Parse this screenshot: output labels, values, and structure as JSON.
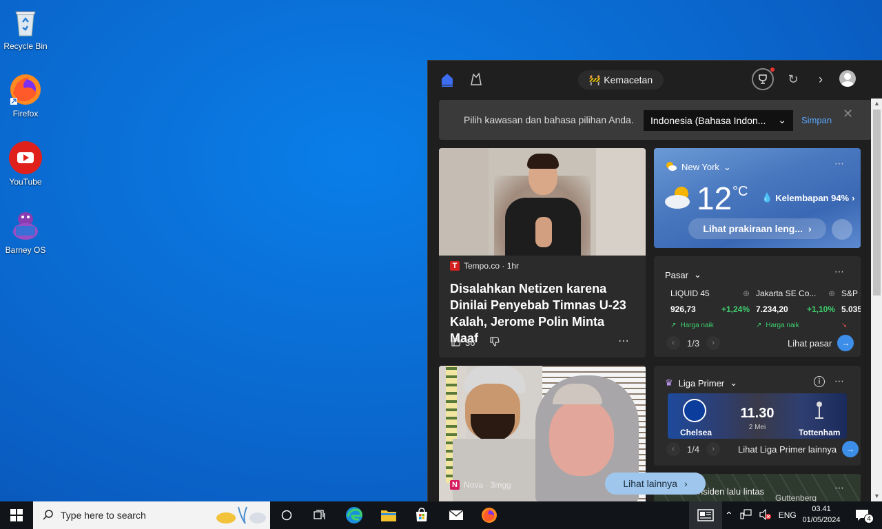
{
  "desktop": {
    "icons": [
      {
        "label": "Recycle Bin"
      },
      {
        "label": "Firefox"
      },
      {
        "label": "YouTube"
      },
      {
        "label": "Barney OS"
      }
    ]
  },
  "news": {
    "traffic_label": "Kemacetan",
    "banner": {
      "message": "Pilih kawasan dan bahasa pilihan Anda.",
      "selected_region": "Indonesia (Bahasa Indon...",
      "save_label": "Simpan"
    },
    "articles": [
      {
        "source": "Tempo.co · 1hr",
        "source_logo": "T",
        "headline": "Disalahkan Netizen karena Dinilai Penyebab Timnas U-23 Kalah, Jerome Polin Minta Maaf",
        "likes": "36"
      },
      {
        "source": "Nova · 3mgg",
        "source_logo": "N"
      }
    ],
    "weather": {
      "location": "New York",
      "temperature": "12",
      "unit": "°C",
      "humidity": "Kelembapan 94%",
      "forecast_label": "Lihat prakiraan leng..."
    },
    "market": {
      "title": "Pasar",
      "stocks": [
        {
          "name": "LIQUID 45",
          "value": "926,73",
          "change": "+1,24%",
          "trend": "Harga naik"
        },
        {
          "name": "Jakarta SE Co...",
          "value": "7.234,20",
          "change": "+1,10%",
          "trend": "Harga naik"
        },
        {
          "name": "S&P 5",
          "value": "5.035",
          "change": "",
          "trend": ""
        }
      ],
      "page": "1/3",
      "see_label": "Lihat pasar"
    },
    "league": {
      "title": "Liga Primer",
      "home": "Chelsea",
      "away": "Tottenham",
      "time": "11.30",
      "date": "2 Mei",
      "page": "1/4",
      "see_label": "Lihat Liga Primer lainnya"
    },
    "map_caption": "nsiden lalu lintas",
    "map_place": "Guttenberg",
    "see_more": "Lihat lainnya"
  },
  "taskbar": {
    "search_placeholder": "Type here to search",
    "language": "ENG",
    "time": "03.41",
    "date": "01/05/2024",
    "notifications": "4"
  },
  "colors": {
    "accent": "#3d8ee8",
    "positive": "#3ecf6e",
    "panel_bg": "#1f1f1f"
  }
}
